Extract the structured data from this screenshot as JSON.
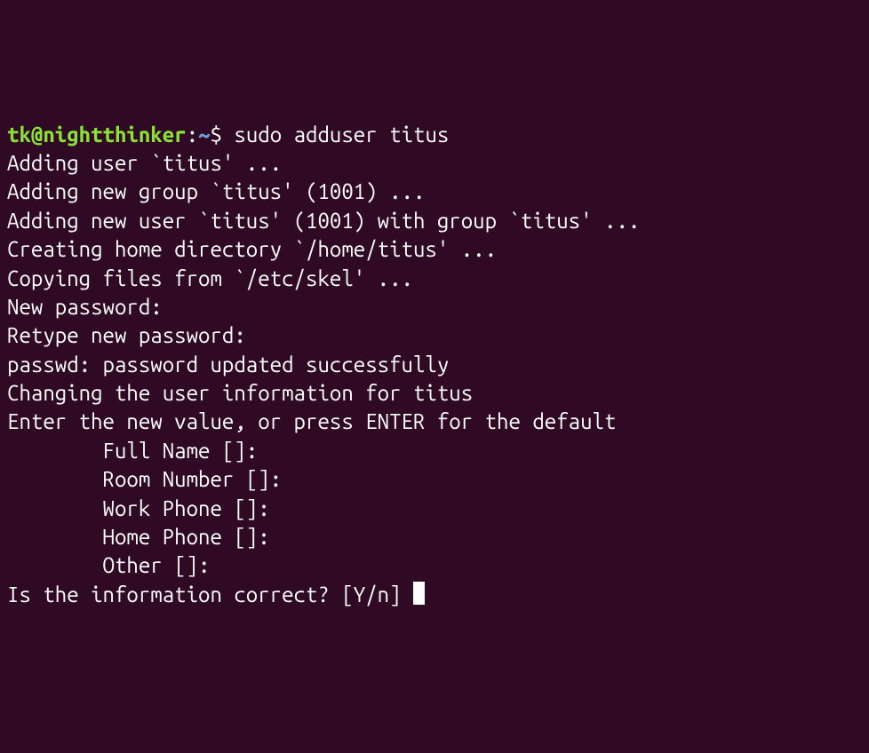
{
  "prompt": {
    "user_host": "tk@nightthinker",
    "separator": ":",
    "path": "~",
    "dollar": "$ "
  },
  "command": "sudo adduser titus",
  "output": {
    "l1": "Adding user `titus' ...",
    "l2": "Adding new group `titus' (1001) ...",
    "l3": "Adding new user `titus' (1001) with group `titus' ...",
    "l4": "Creating home directory `/home/titus' ...",
    "l5": "Copying files from `/etc/skel' ...",
    "l6": "New password: ",
    "l7": "Retype new password: ",
    "l8": "passwd: password updated successfully",
    "l9": "Changing the user information for titus",
    "l10": "Enter the new value, or press ENTER for the default",
    "l11": "        Full Name []: ",
    "l12": "        Room Number []: ",
    "l13": "        Work Phone []: ",
    "l14": "        Home Phone []: ",
    "l15": "        Other []: ",
    "l16": "Is the information correct? [Y/n] "
  }
}
